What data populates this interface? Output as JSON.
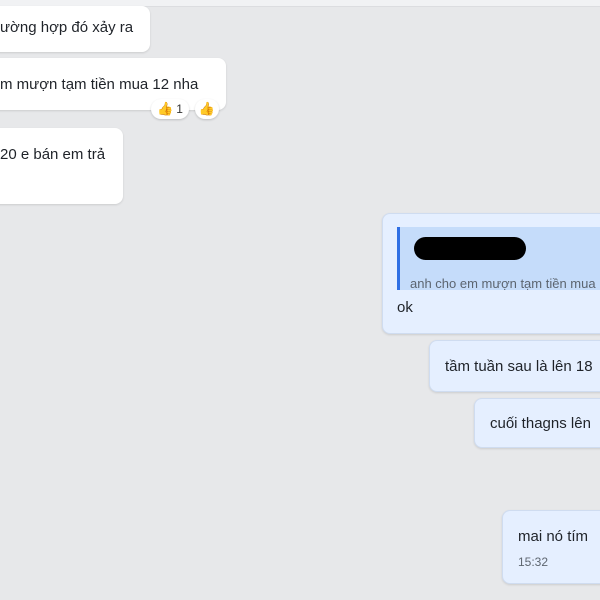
{
  "messages": [
    {
      "id": "m1",
      "direction": "incoming",
      "text": "ường hợp đó xảy ra"
    },
    {
      "id": "m2",
      "direction": "incoming",
      "text": "m mượn tạm tiền mua 12 nha",
      "reactions": {
        "emoji": "thumbs-up-icon",
        "count": "1",
        "quick_react_emoji": "thumbs-up-icon"
      }
    },
    {
      "id": "m3",
      "direction": "incoming",
      "text": "20 e bán em trả"
    },
    {
      "id": "m4",
      "direction": "outgoing",
      "text": "ok",
      "quote": {
        "text": "anh cho em mượn tạm tiền mua",
        "author_redacted": true
      }
    },
    {
      "id": "m5",
      "direction": "outgoing",
      "text": "tầm tuần sau là lên 18"
    },
    {
      "id": "m6",
      "direction": "outgoing",
      "text": "cuối thagns lên"
    },
    {
      "id": "m7",
      "direction": "outgoing",
      "text": "mai nó tím",
      "time": "15:32"
    }
  ],
  "colors": {
    "background": "#e7e8ea",
    "incoming_bubble": "#ffffff",
    "outgoing_bubble": "#e5efff",
    "quote_background": "#c5dcfa",
    "quote_accent": "#2f6fe4"
  }
}
